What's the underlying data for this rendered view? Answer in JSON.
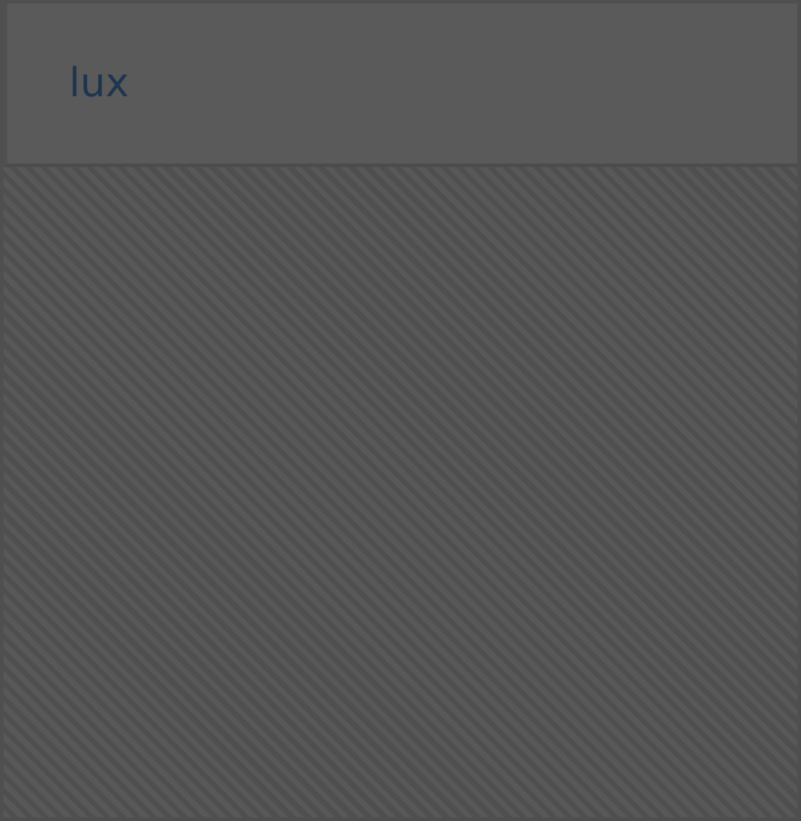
{
  "header": {
    "title": "lux"
  }
}
